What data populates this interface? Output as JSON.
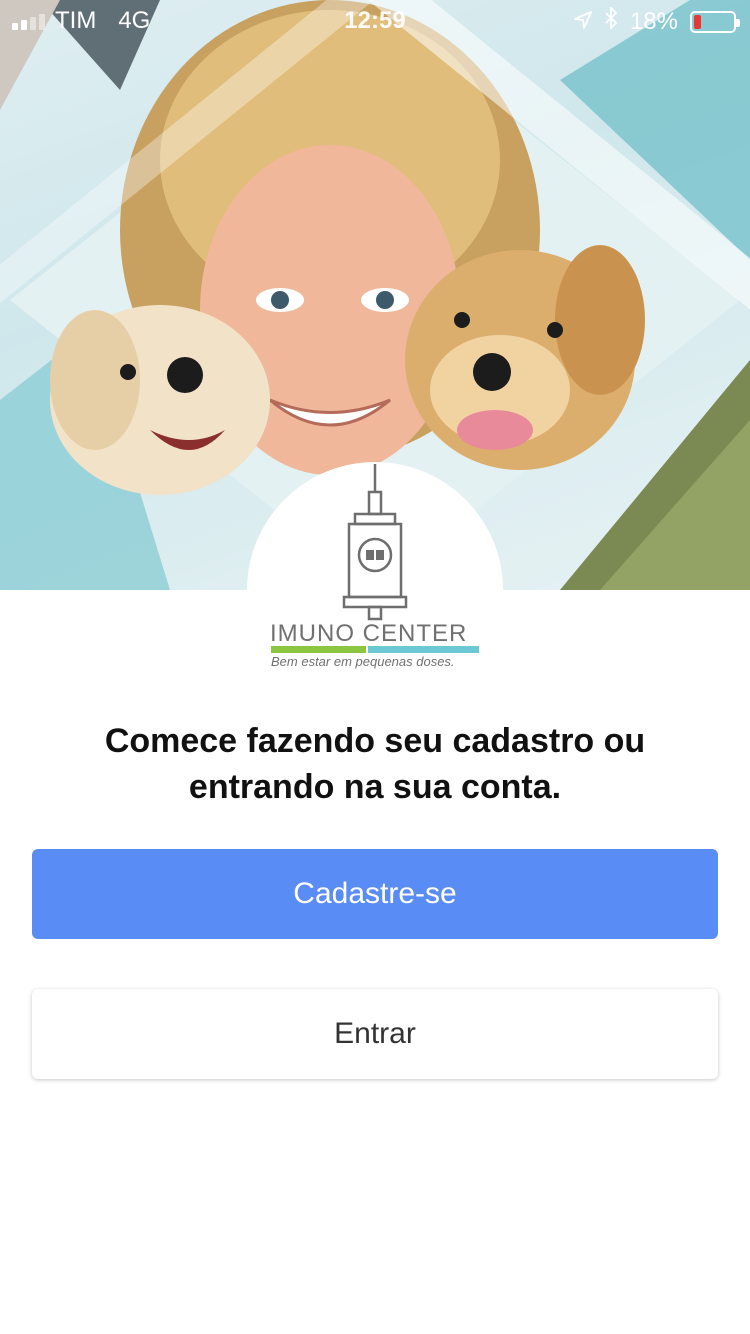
{
  "status_bar": {
    "carrier": "TIM",
    "network": "4G",
    "time": "12:59",
    "battery_percent": "18%",
    "battery_level": 0.18,
    "location_icon": "location-arrow-icon",
    "bluetooth_icon": "bluetooth-icon"
  },
  "hero": {
    "image": "girl-with-two-puppies-photo"
  },
  "brand": {
    "logo_icon": "syringe-icon",
    "name": "IMUNO CENTER",
    "tagline": "Bem estar em pequenas doses.",
    "colors": {
      "green": "#8cc63f",
      "teal": "#6cc9d4",
      "gray": "#707070"
    }
  },
  "content": {
    "headline": "Comece fazendo seu cadastro ou entrando na sua conta.",
    "signup_button": "Cadastre-se",
    "login_button": "Entrar"
  },
  "colors": {
    "primary": "#5a8cf6",
    "primary_text": "#ffffff",
    "secondary_text": "#333333"
  }
}
